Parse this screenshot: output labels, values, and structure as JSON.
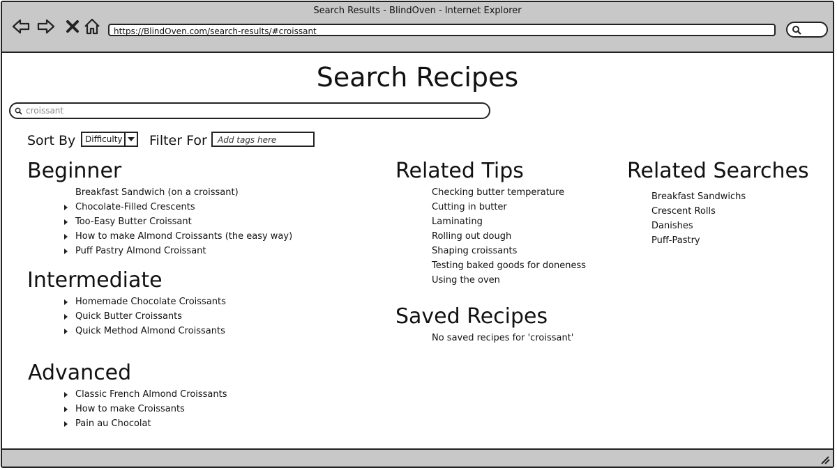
{
  "window": {
    "title": "Search Results - BlindOven - Internet Explorer"
  },
  "toolbar": {
    "url": "https://BlindOven.com/search-results/#croissant",
    "icons": [
      "back-icon",
      "forward-icon",
      "stop-icon",
      "home-icon",
      "search-icon"
    ]
  },
  "page": {
    "title": "Search Recipes",
    "search_value": "croissant",
    "sort_label": "Sort By",
    "sort_value": "Difficulty",
    "filter_label": "Filter For",
    "filter_placeholder": "Add tags here"
  },
  "beginner": {
    "heading": "Beginner",
    "items": [
      "Breakfast Sandwich (on a croissant)",
      "Chocolate-Filled Crescents",
      "Too-Easy Butter Croissant",
      "How to make Almond Croissants (the easy way)",
      "Puff Pastry Almond Croissant"
    ]
  },
  "intermediate": {
    "heading": "Intermediate",
    "items": [
      "Homemade Chocolate Croissants",
      "Quick Butter Croissants",
      "Quick Method Almond Croissants"
    ]
  },
  "advanced": {
    "heading": "Advanced",
    "items": [
      "Classic French Almond Croissants",
      "How to make Croissants",
      "Pain au Chocolat"
    ]
  },
  "tips": {
    "heading": "Related Tips",
    "items": [
      "Checking butter temperature",
      "Cutting in butter",
      "Laminating",
      "Rolling out dough",
      "Shaping croissants",
      "Testing baked goods for doneness",
      "Using the oven"
    ]
  },
  "saved": {
    "heading": "Saved Recipes",
    "message": "No saved recipes for 'croissant'"
  },
  "related_searches": {
    "heading": "Related Searches",
    "items": [
      "Breakfast Sandwichs",
      "Crescent Rolls",
      "Danishes",
      "Puff-Pastry"
    ]
  }
}
